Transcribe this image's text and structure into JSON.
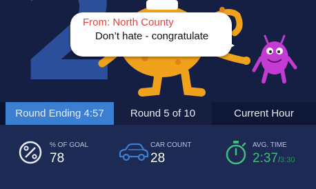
{
  "theme": {
    "accent": "#3c7fd0",
    "from_color": "#e8413c",
    "time_color": "#3fbf7a",
    "monster_orange": "#f1a21d",
    "monster_purple": "#c43bd3"
  },
  "hero": {
    "big_digit": "2",
    "bubble": {
      "from": "From: North County",
      "message": "Don’t hate - congratulate"
    }
  },
  "tabs": [
    {
      "label": "Round Ending 4:57",
      "active": true
    },
    {
      "label": "Round 5 of 10",
      "active": false
    },
    {
      "label": "Current Hour",
      "active": false
    }
  ],
  "stats": {
    "goal": {
      "icon": "percent-circle-icon",
      "label": "% OF GOAL",
      "value": "78"
    },
    "cars": {
      "icon": "car-icon",
      "label": "CAR COUNT",
      "value": "28"
    },
    "time": {
      "icon": "stopwatch-icon",
      "label": "AVG. TIME",
      "value": "2:37",
      "separator": "/",
      "target": "3:30"
    }
  }
}
